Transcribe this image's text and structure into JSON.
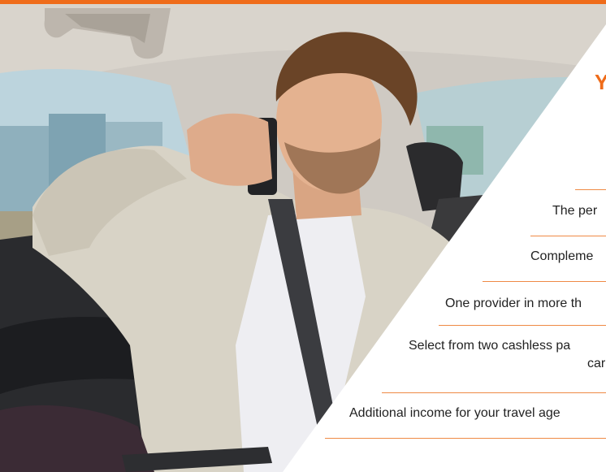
{
  "brand": {
    "accent": "#ef6c1a"
  },
  "hero": {
    "image": "businessman-phone-in-car",
    "headline": "Y"
  },
  "features": [
    {
      "text": "The per"
    },
    {
      "text": "Compleme"
    },
    {
      "text": "One provider in more th"
    },
    {
      "line1": "Select from two cashless pa",
      "line2": "car"
    },
    {
      "text": "Additional income for your travel age"
    }
  ]
}
